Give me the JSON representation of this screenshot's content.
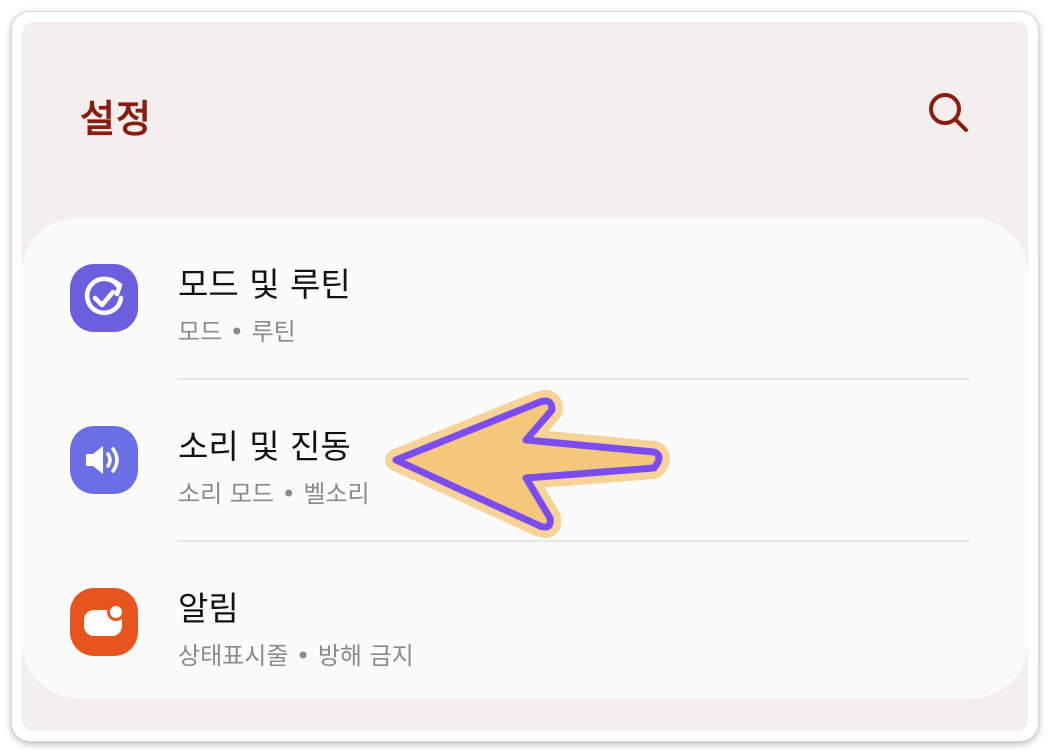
{
  "header": {
    "title": "설정",
    "search_icon": "search-icon"
  },
  "settings": {
    "items": [
      {
        "label": "모드 및 루틴",
        "sub": "모드 • 루틴",
        "icon": "modes-routines-icon",
        "color": "#6b5fe0"
      },
      {
        "label": "소리 및 진동",
        "sub": "소리 모드 • 벨소리",
        "icon": "sound-icon",
        "color": "#6b6fe6"
      },
      {
        "label": "알림",
        "sub": "상태표시줄 • 방해 금지",
        "icon": "notifications-icon",
        "color": "#e8541e"
      }
    ]
  },
  "annotation": {
    "arrow_icon": "pointer-arrow-icon",
    "fill": "#f5c77a",
    "stroke": "#7b4cf0"
  },
  "colors": {
    "title": "#8a1c10",
    "background": "#f4eeee",
    "card": "#fcfbfb"
  }
}
